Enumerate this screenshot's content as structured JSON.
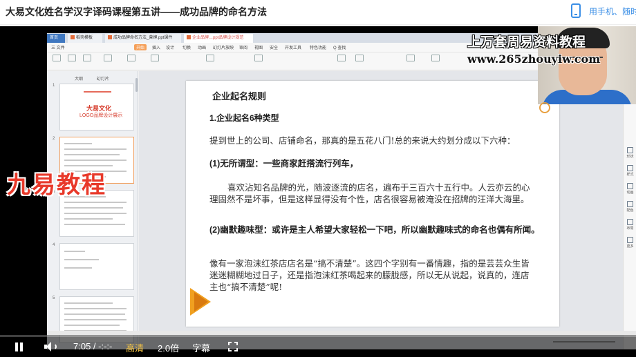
{
  "page": {
    "title": "大易文化姓名学汉字译码课程第五讲——成功品牌的命名方法",
    "mobile_link": "用手机、随时"
  },
  "wps": {
    "tabs": [
      "首页",
      "稻壳模板",
      "成功品牌命名方法_曾婶.ppt课件",
      "企业品牌…ppt品牌设计规范"
    ],
    "menu": [
      "三 文件",
      "开始",
      "插入",
      "设计",
      "切换",
      "动画",
      "幻灯片放映",
      "审阅",
      "视图",
      "安全",
      "开发工具",
      "特色功能",
      "Q 查找"
    ],
    "panel_tabs": [
      "大纲",
      "幻灯片"
    ],
    "slide_numbers": [
      "1",
      "2",
      "3",
      "4",
      "5"
    ],
    "thumb1_title": "大易文化",
    "thumb1_sub": "LOGO品牌设计展示",
    "right_bar": [
      "形状",
      "样式",
      "动画",
      "配色",
      "布局",
      "更多"
    ]
  },
  "slide": {
    "heading": "企业起名规则",
    "subheading": "1.企业起名6种类型",
    "intro": "提到世上的公司、店铺命名，那真的是五花八门!总的来说大约划分成以下六种：",
    "type1_title": "(1)无所谓型：一些商家赶搭流行列车，",
    "type1_body": "喜欢沾知名品牌的光，随波逐流的店名，遍布于三百六十五行中。人云亦云的心理固然不是坏事，但是这样显得没有个性，店名很容易被淹没在招牌的汪洋大海里。",
    "type2_title": "(2)幽默趣味型：或许是主人希望大家轻松一下吧，所以幽默趣味式的命名也偶有所闻。",
    "type2_body": "像有一家泡沫红茶店店名是“搞不清楚”。这四个字别有一番情趣，指的是芸芸众生皆迷迷糊糊地过日子，还是指泡沫红茶喝起来的朦胧感，所以无从说起，说真的，连店主也“搞不清楚”呢!"
  },
  "overlay": {
    "watermark_line1": "上万套周易资料教程",
    "watermark_line2": "www.265zhouyiw.com",
    "big_watermark": "九易教程"
  },
  "player": {
    "time": "7:05 / -:-:-",
    "quality": "高清",
    "speed": "2.0倍",
    "subtitle": "字幕"
  }
}
